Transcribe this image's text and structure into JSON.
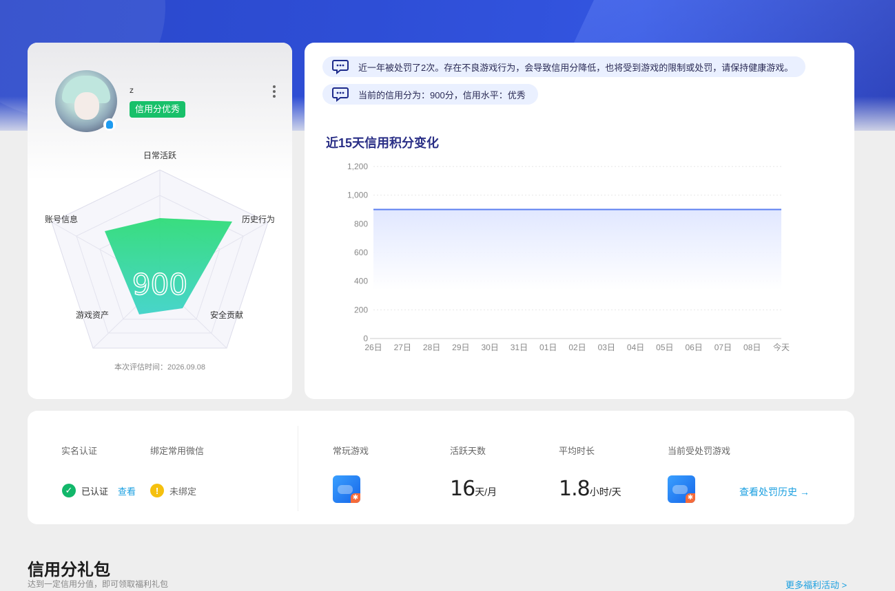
{
  "profile": {
    "nickname": "z",
    "credit_tag": "信用分优秀",
    "score": "900",
    "radar_labels": {
      "top": "日常活跃",
      "right": "历史行为",
      "bottom_right": "安全贡献",
      "bottom_left": "游戏资产",
      "left": "账号信息"
    },
    "eval_time": "本次评估时间：2026.09.08"
  },
  "notices": {
    "penalty": "近一年被处罚了2次。存在不良游戏行为，会导致信用分降低，也将受到游戏的限制或处罚，请保持健康游戏。",
    "current": "当前的信用分为：900分，信用水平：优秀"
  },
  "chart_data": {
    "type": "area",
    "title": "近15天信用积分变化",
    "categories": [
      "26日",
      "27日",
      "28日",
      "29日",
      "30日",
      "31日",
      "01日",
      "02日",
      "03日",
      "04日",
      "05日",
      "06日",
      "07日",
      "08日",
      "今天"
    ],
    "values": [
      900,
      900,
      900,
      900,
      900,
      900,
      900,
      900,
      900,
      900,
      900,
      900,
      900,
      900,
      900
    ],
    "y_ticks": [
      "0",
      "200",
      "400",
      "600",
      "800",
      "1,000",
      "1,200"
    ],
    "ylim": [
      0,
      1200
    ],
    "grid": true,
    "color": "#5b7ef0"
  },
  "stats": {
    "real_name_label": "实名认证",
    "real_name_status": "已认证",
    "real_name_link": "查看",
    "wechat_label": "绑定常用微信",
    "wechat_status": "未绑定",
    "fav_game_label": "常玩游戏",
    "active_days_label": "活跃天数",
    "active_days_value": "16",
    "active_days_unit": "天/月",
    "avg_time_label": "平均时长",
    "avg_time_value": "1.8",
    "avg_time_unit": "小时/天",
    "penalty_game_label": "当前受处罚游戏",
    "history_link": "查看处罚历史 →"
  },
  "gift": {
    "title": "信用分礼包",
    "subtitle": "达到一定信用分值，即可领取福利礼包",
    "more": "更多福利活动 >"
  }
}
